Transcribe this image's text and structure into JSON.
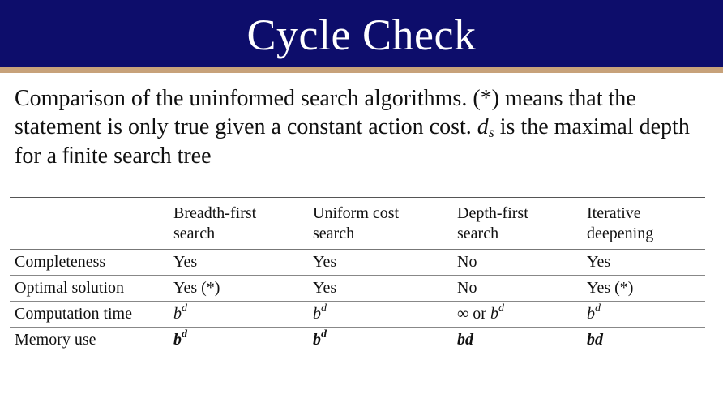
{
  "slide": {
    "title": "Cycle Check",
    "colors": {
      "title_bar": "#0d0d6b",
      "title_rule": "#c7a27a",
      "title_text": "#ffffff"
    }
  },
  "body": {
    "part1": "Comparison of the uninformed search algorithms. (*) means that the statement is only true given a constant action cost. ",
    "ds_base": "d",
    "ds_sub": "s",
    "part2": " is the maximal depth for a ",
    "fi_ligature": "fi",
    "part3": "nite search tree"
  },
  "table": {
    "headers": [
      {
        "line1": "",
        "line2": ""
      },
      {
        "line1": "Breadth-first",
        "line2": "search"
      },
      {
        "line1": "Uniform cost",
        "line2": "search"
      },
      {
        "line1": "Depth-first",
        "line2": "search"
      },
      {
        "line1": "Iterative",
        "line2": "deepening"
      }
    ],
    "rows": {
      "completeness": {
        "label": "Completeness",
        "values": [
          "Yes",
          "Yes",
          "No",
          "Yes"
        ]
      },
      "optimal": {
        "label": "Optimal solution",
        "values": [
          "Yes (*)",
          "Yes",
          "No",
          "Yes (*)"
        ]
      },
      "time": {
        "label": "Computation time",
        "b": "b",
        "d": "d",
        "infinity": "∞",
        "or": " or "
      },
      "memory": {
        "label": "Memory use",
        "b": "b",
        "d": "d",
        "bd": "bd"
      }
    }
  }
}
